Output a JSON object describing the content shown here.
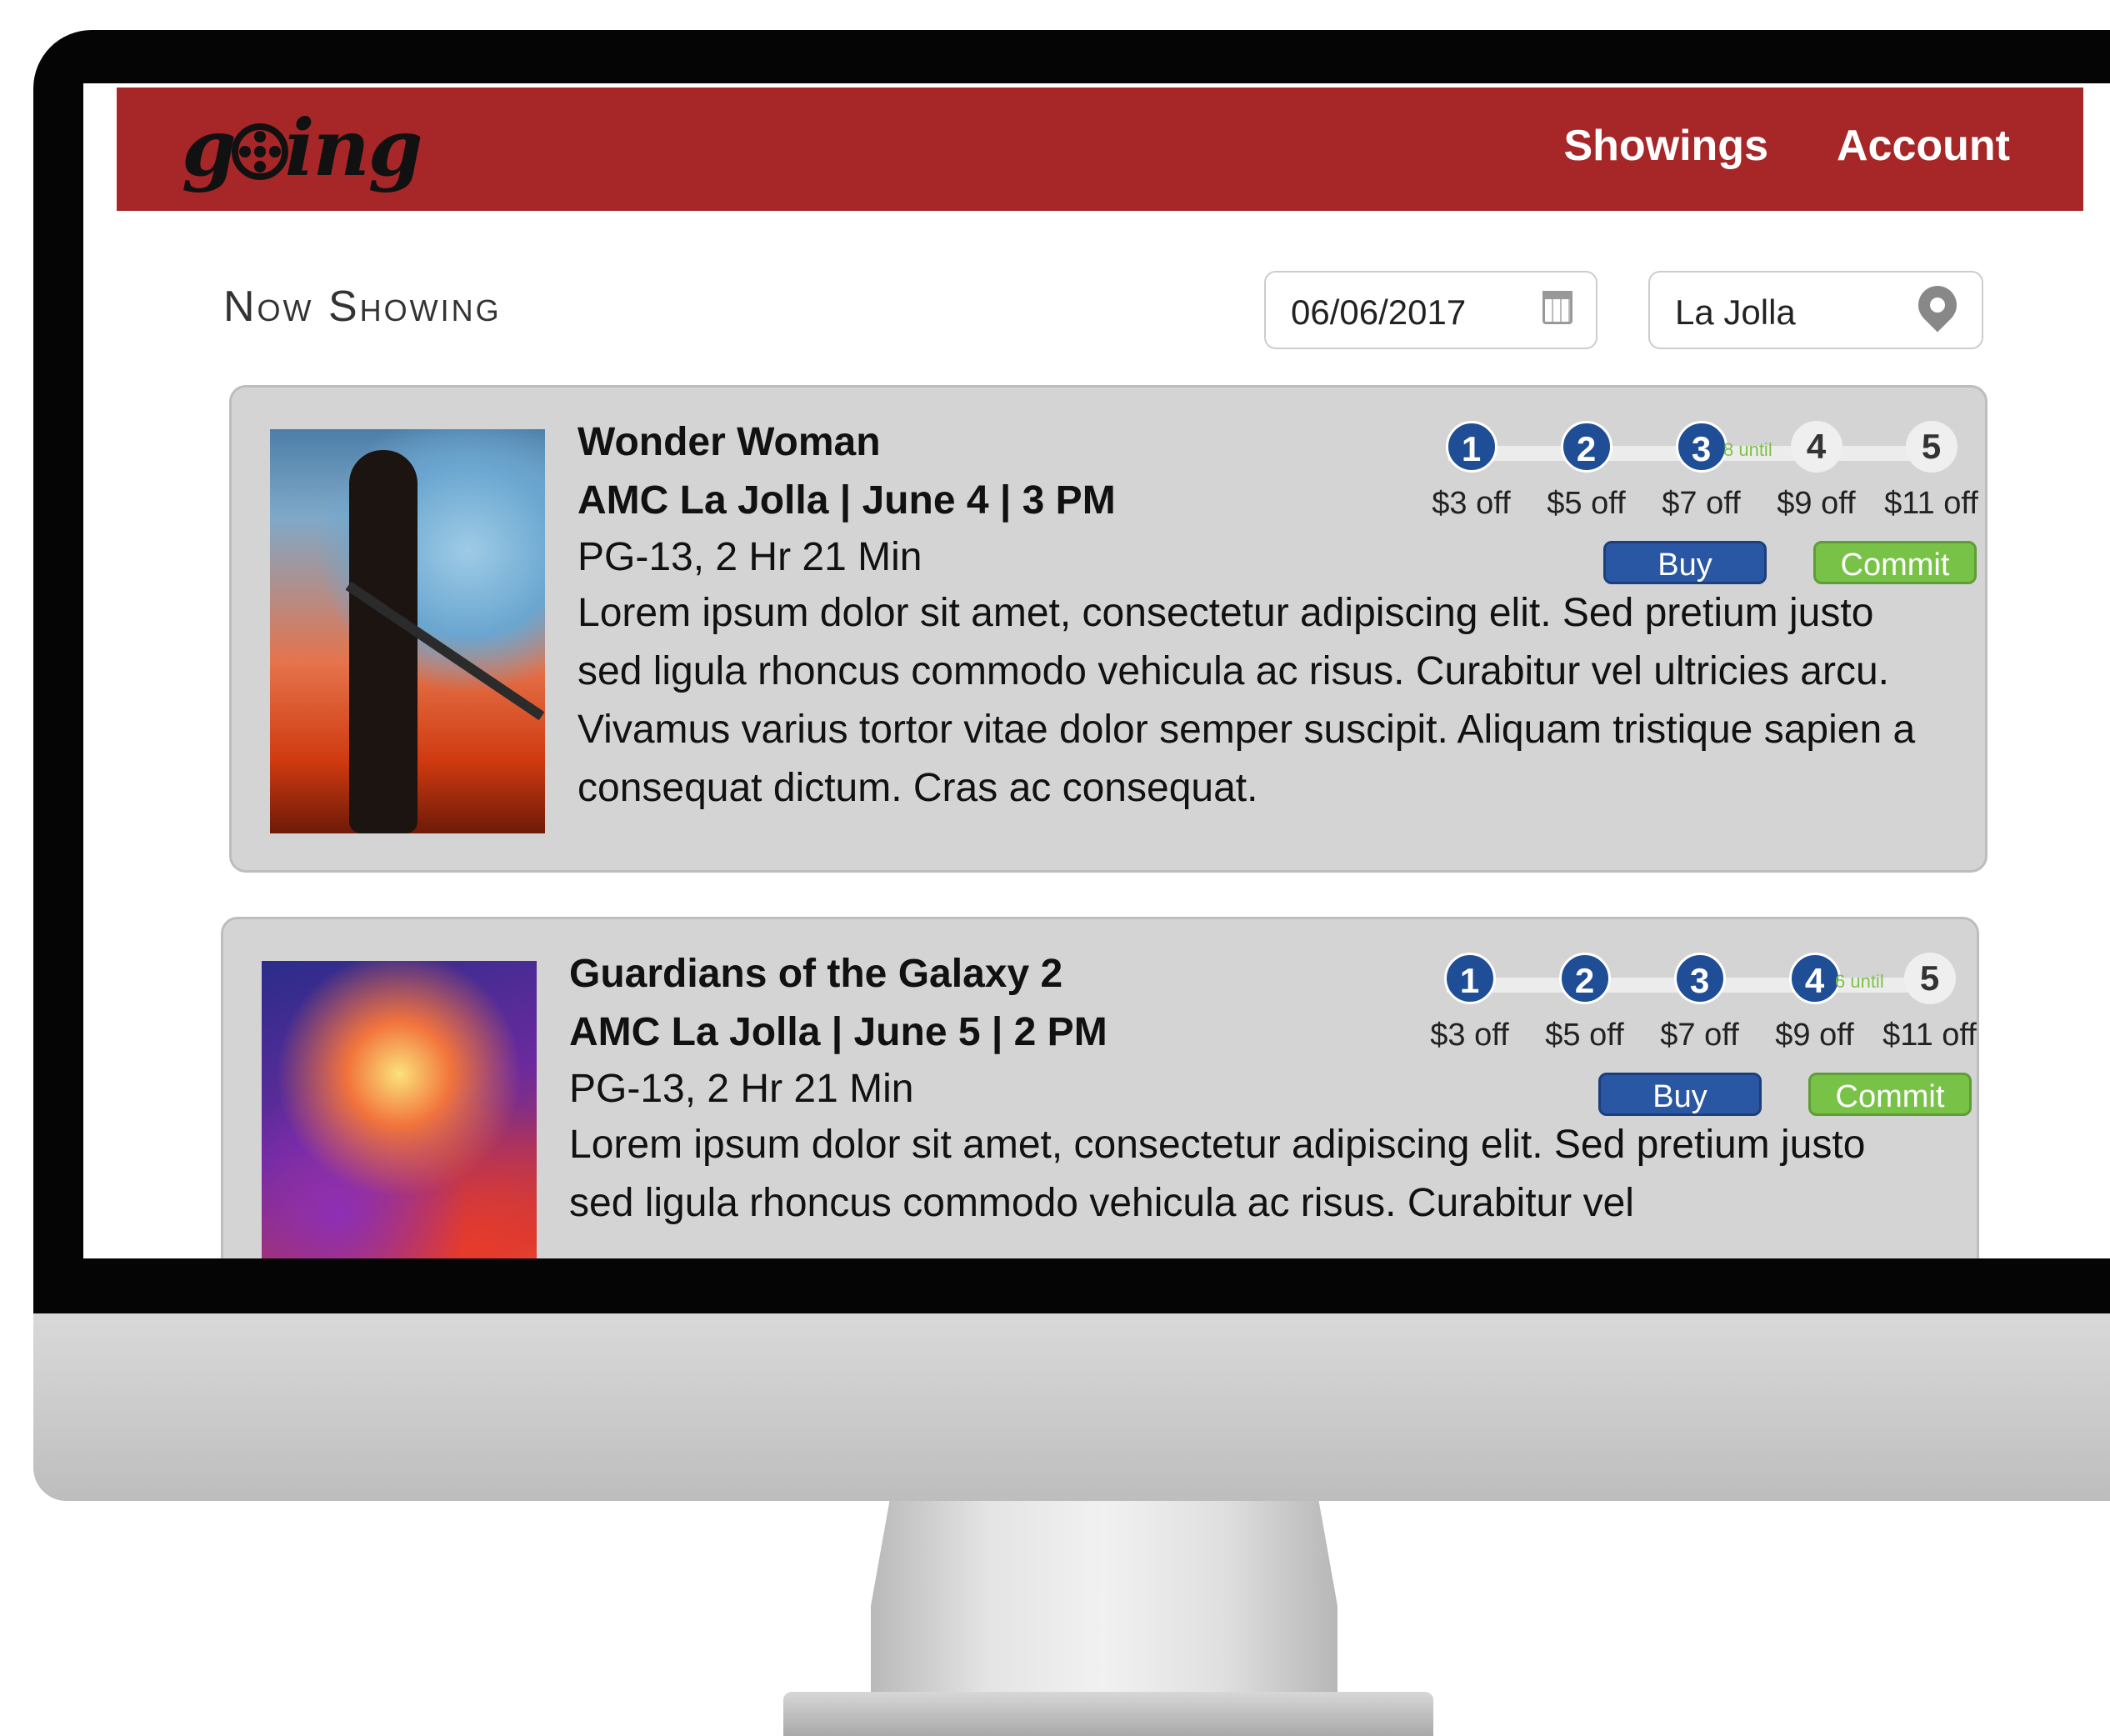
{
  "brand": {
    "logo_text_prefix": "g",
    "logo_text_suffix": "ing"
  },
  "nav": {
    "showings_label": "Showings",
    "account_label": "Account"
  },
  "toolbar": {
    "heading": "Now Showing",
    "date_value": "06/06/2017",
    "location_value": "La Jolla"
  },
  "colors": {
    "nav_bg": "#a72628",
    "tier_active": "#1f4e96",
    "buy_button": "#2a57a3",
    "commit_button": "#78c247",
    "until_text": "#7fc148",
    "card_bg": "#d4d4d4"
  },
  "icons": {
    "date_field": "calendar-icon",
    "location_field": "map-pin-icon",
    "logo_mark": "film-reel-icon"
  },
  "movies": [
    {
      "title": "Wonder Woman",
      "venue": "AMC La Jolla | June 4 | 3 PM",
      "meta": "PG-13, 2 Hr 21 Min",
      "description": "Lorem ipsum dolor sit amet, consectetur adipiscing elit. Sed pretium justo sed ligula rhoncus commodo vehicula ac risus. Curabitur vel ultricies arcu. Vivamus varius tortor vitae dolor semper suscipit. Aliquam tristique sapien a consequat dictum. Cras ac consequat.",
      "until_text": "8 until",
      "active_tiers": 3,
      "tiers": [
        {
          "number": "1",
          "discount": "$3 off"
        },
        {
          "number": "2",
          "discount": "$5 off"
        },
        {
          "number": "3",
          "discount": "$7 off"
        },
        {
          "number": "4",
          "discount": "$9 off"
        },
        {
          "number": "5",
          "discount": "$11 off"
        }
      ],
      "buy_label": "Buy",
      "commit_label": "Commit"
    },
    {
      "title": "Guardians of the Galaxy 2",
      "venue": "AMC La Jolla | June 5 | 2 PM",
      "meta": "PG-13, 2 Hr 21 Min",
      "description": "Lorem ipsum dolor sit amet, consectetur adipiscing elit. Sed pretium justo sed ligula rhoncus commodo vehicula ac risus. Curabitur vel",
      "until_text": "6 until",
      "active_tiers": 4,
      "tiers": [
        {
          "number": "1",
          "discount": "$3 off"
        },
        {
          "number": "2",
          "discount": "$5 off"
        },
        {
          "number": "3",
          "discount": "$7 off"
        },
        {
          "number": "4",
          "discount": "$9 off"
        },
        {
          "number": "5",
          "discount": "$11 off"
        }
      ],
      "buy_label": "Buy",
      "commit_label": "Commit"
    }
  ]
}
